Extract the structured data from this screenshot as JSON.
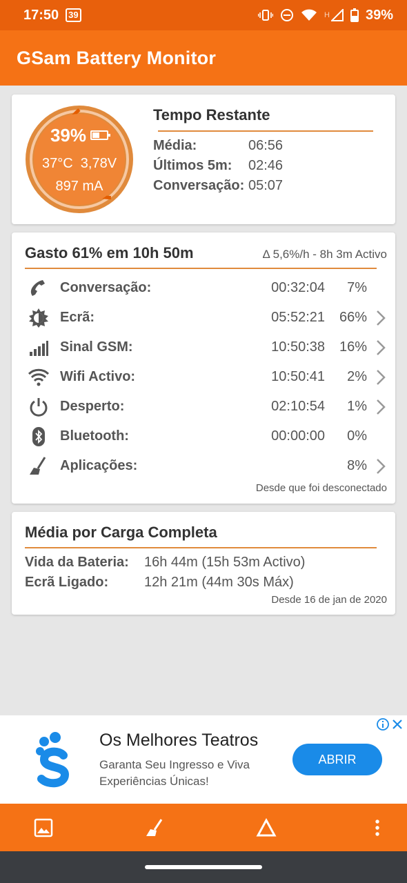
{
  "status_bar": {
    "time": "17:50",
    "notification_badge": "39",
    "battery_percent": "39%",
    "network_letter": "H"
  },
  "app_bar": {
    "title": "GSam Battery Monitor"
  },
  "battery_gauge": {
    "percent": "39%",
    "level": 0.39,
    "temperature": "37°C",
    "voltage": "3,78V",
    "current": "897 mA"
  },
  "tempo_restante": {
    "title": "Tempo Restante",
    "rows": [
      {
        "label": "Média:",
        "value": "06:56"
      },
      {
        "label": "Últimos 5m:",
        "value": "02:46"
      },
      {
        "label": "Conversação:",
        "value": "05:07"
      }
    ]
  },
  "usage": {
    "title": "Gasto 61% em 10h 50m",
    "subtitle": "Δ 5,6%/h - 8h 3m Activo",
    "rows": [
      {
        "label": "Conversação:",
        "time": "00:32:04",
        "percent": "7%",
        "icon": "phone-icon",
        "has_chevron": false
      },
      {
        "label": "Ecrã:",
        "time": "05:52:21",
        "percent": "66%",
        "icon": "brightness-icon",
        "has_chevron": true
      },
      {
        "label": "Sinal GSM:",
        "time": "10:50:38",
        "percent": "16%",
        "icon": "signal-bars-icon",
        "has_chevron": true
      },
      {
        "label": "Wifi Activo:",
        "time": "10:50:41",
        "percent": "2%",
        "icon": "wifi-icon",
        "has_chevron": true
      },
      {
        "label": "Desperto:",
        "time": "02:10:54",
        "percent": "1%",
        "icon": "power-icon",
        "has_chevron": true
      },
      {
        "label": "Bluetooth:",
        "time": "00:00:00",
        "percent": "0%",
        "icon": "bluetooth-icon",
        "has_chevron": false
      },
      {
        "label": "Aplicações:",
        "time": "",
        "percent": "8%",
        "icon": "broom-icon",
        "has_chevron": true
      }
    ],
    "footnote": "Desde que foi desconectado"
  },
  "media_carga": {
    "title": "Média por Carga Completa",
    "rows": [
      {
        "label": "Vida da Bateria:",
        "value": "16h 44m (15h 53m Activo)"
      },
      {
        "label": "Ecrã Ligado:",
        "value": "12h 21m (44m 30s Máx)"
      }
    ],
    "footnote": "Desde 16 de jan de 2020"
  },
  "ad": {
    "title": "Os Melhores Teatros",
    "body": "Garanta Seu Ingresso e Viva Experiências Únicas!",
    "button": "ABRIR"
  },
  "colors": {
    "accent": "#f57215",
    "status_bar": "#e8600c",
    "divider": "#e08a3c",
    "ad_button": "#1a8be8"
  },
  "bottom_bar": {
    "icons": [
      "image-icon",
      "broom-icon",
      "delta-icon",
      "more-vert-icon"
    ]
  }
}
